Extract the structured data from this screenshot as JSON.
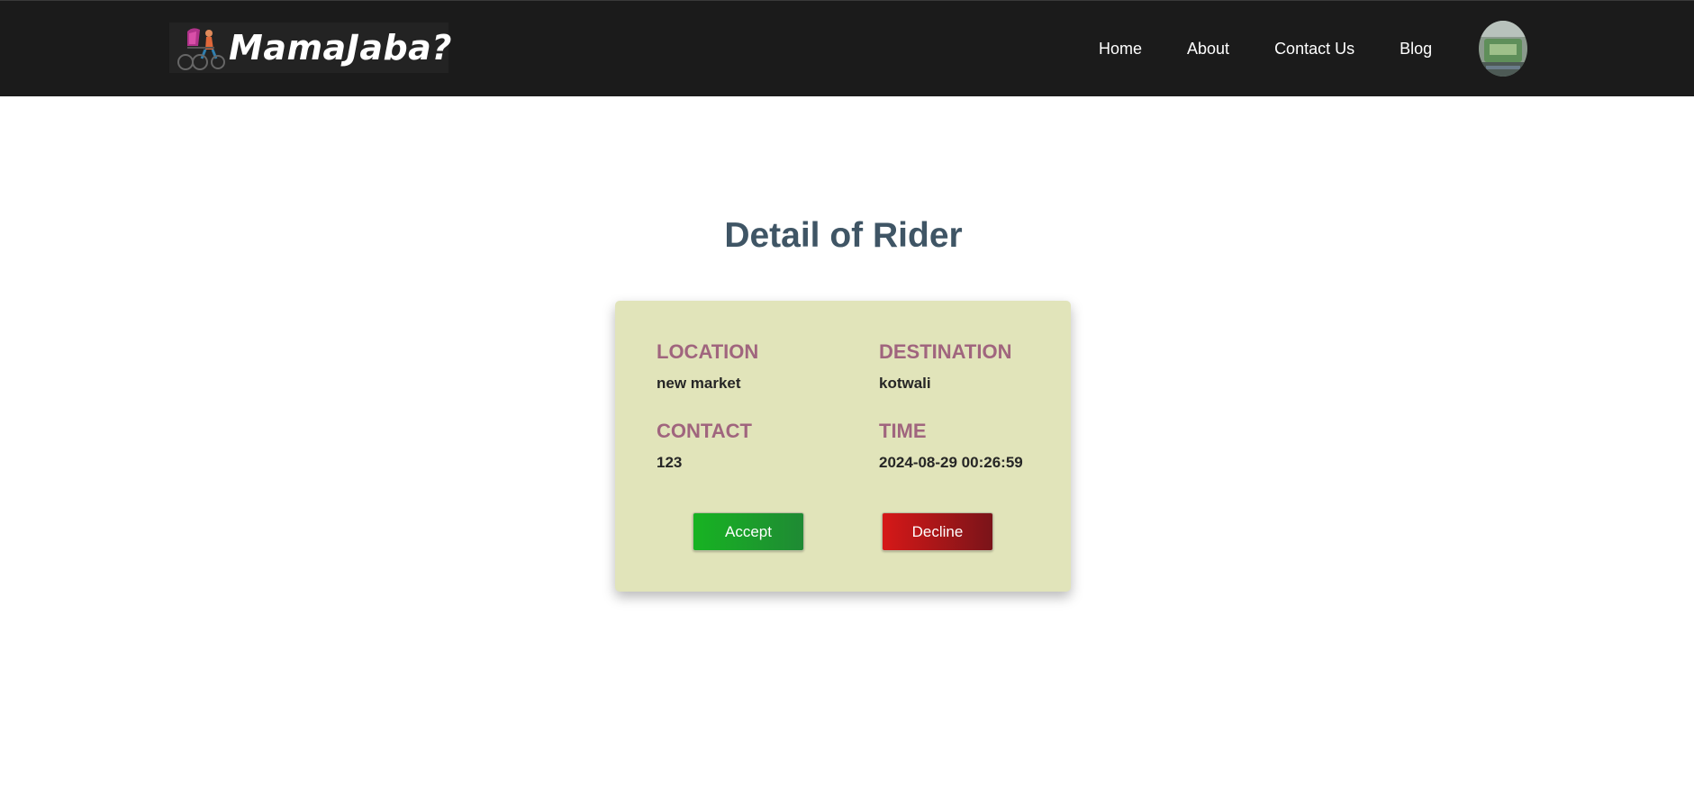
{
  "brand": {
    "logo_text": "MamaJaba?",
    "logo_image": "rickshaw-logo"
  },
  "nav": {
    "links": [
      {
        "label": "Home"
      },
      {
        "label": "About"
      },
      {
        "label": "Contact Us"
      },
      {
        "label": "Blog"
      }
    ],
    "avatar": "user-avatar"
  },
  "page": {
    "title": "Detail of Rider"
  },
  "rider": {
    "location_label": "LOCATION",
    "location": "new market",
    "destination_label": "DESTINATION",
    "destination": "kotwali",
    "contact_label": "CONTACT",
    "contact": "123",
    "time_label": "TIME",
    "time": "2024-08-29 00:26:59"
  },
  "actions": {
    "accept_label": "Accept",
    "decline_label": "Decline"
  },
  "colors": {
    "navbar": "#1b1b1b",
    "title": "#3f5565",
    "card": "#e1e4ba",
    "field_label": "#a0657e",
    "accept": "#1ba52a",
    "decline": "#b5161a"
  }
}
